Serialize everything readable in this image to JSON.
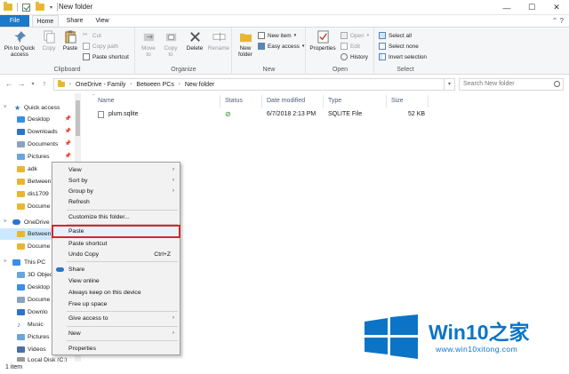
{
  "window": {
    "title": "New folder",
    "controls": {
      "minimize": "—",
      "maximize": "☐",
      "close": "✕"
    }
  },
  "ribbon_tabs": {
    "file": "File",
    "home": "Home",
    "share": "Share",
    "view": "View"
  },
  "ribbon": {
    "clipboard": {
      "label": "Clipboard",
      "pin_to_quick_access": "Pin to Quick access",
      "copy": "Copy",
      "paste": "Paste",
      "cut": "Cut",
      "copy_path": "Copy path",
      "paste_shortcut": "Paste shortcut"
    },
    "organize": {
      "label": "Organize",
      "move_to": "Move to",
      "copy_to": "Copy to",
      "delete": "Delete",
      "rename": "Rename"
    },
    "new": {
      "label": "New",
      "new_folder": "New folder",
      "new_item": "New item",
      "easy_access": "Easy access"
    },
    "open": {
      "label": "Open",
      "properties": "Properties",
      "open": "Open",
      "edit": "Edit",
      "history": "History"
    },
    "select": {
      "label": "Select",
      "select_all": "Select all",
      "select_none": "Select none",
      "invert_selection": "Invert selection"
    }
  },
  "address": {
    "crumbs": [
      "OneDrive - Family",
      "Between PCs",
      "New folder"
    ],
    "search_placeholder": "Search New folder"
  },
  "nav_pane": {
    "items": [
      {
        "label": "Quick access",
        "pinned": false
      },
      {
        "label": "Desktop",
        "pinned": true
      },
      {
        "label": "Downloads",
        "pinned": true
      },
      {
        "label": "Documents",
        "pinned": true
      },
      {
        "label": "Pictures",
        "pinned": true
      },
      {
        "label": "adk",
        "pinned": false
      },
      {
        "label": "Between",
        "pinned": false
      },
      {
        "label": "dis1709",
        "pinned": false
      },
      {
        "label": "Docume",
        "pinned": false
      },
      {
        "label": "OneDrive",
        "pinned": false
      },
      {
        "label": "Between",
        "pinned": false
      },
      {
        "label": "Docume",
        "pinned": false
      },
      {
        "label": "This PC",
        "pinned": false
      },
      {
        "label": "3D Object",
        "pinned": false
      },
      {
        "label": "Desktop",
        "pinned": false
      },
      {
        "label": "Docume",
        "pinned": false
      },
      {
        "label": "Downlo",
        "pinned": false
      },
      {
        "label": "Music",
        "pinned": false
      },
      {
        "label": "Pictures",
        "pinned": false
      },
      {
        "label": "Videos",
        "pinned": false
      },
      {
        "label": "Local Disk (C:)",
        "pinned": false
      }
    ]
  },
  "file_list": {
    "columns": {
      "name": "Name",
      "status": "Status",
      "date": "Date modified",
      "type": "Type",
      "size": "Size"
    },
    "rows": [
      {
        "name": "plum.sqlite",
        "date": "6/7/2018 2:13 PM",
        "type": "SQLITE File",
        "size": "52 KB"
      }
    ]
  },
  "status_bar": {
    "count": "1 item"
  },
  "context_menu": {
    "view": "View",
    "sort_by": "Sort by",
    "group_by": "Group by",
    "refresh": "Refresh",
    "customize": "Customize this folder...",
    "paste": "Paste",
    "paste_shortcut": "Paste shortcut",
    "undo_copy": "Undo Copy",
    "undo_shortcut": "Ctrl+Z",
    "share": "Share",
    "view_online": "View online",
    "always_keep": "Always keep on this device",
    "free_up_space": "Free up space",
    "give_access": "Give access to",
    "new": "New",
    "properties": "Properties"
  },
  "watermark": {
    "brand": "Win10",
    "brand_suffix": "之家",
    "url": "www.win10xitong.com"
  },
  "colors": {
    "accent": "#1979ca",
    "highlight_outline": "#d9252a",
    "selection": "#cce8ff",
    "folder": "#e8b732",
    "logo_blue": "#0b74c6"
  }
}
